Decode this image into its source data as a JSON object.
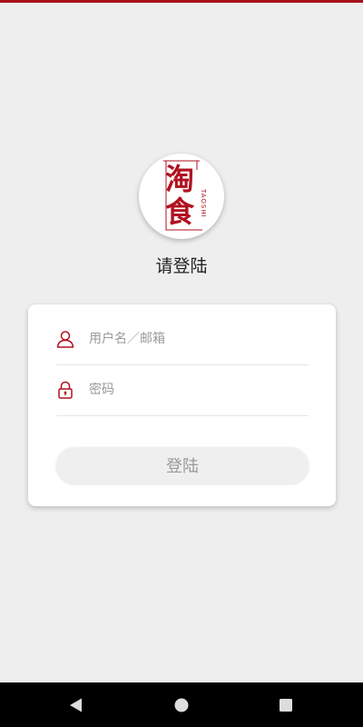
{
  "logo": {
    "chars": [
      "淘",
      "食"
    ],
    "side_text": "TAOSHI",
    "brand_color": "#b01220"
  },
  "login": {
    "title": "请登陆",
    "username_placeholder": "用户名／邮箱",
    "password_placeholder": "密码",
    "button_label": "登陆"
  },
  "icons": {
    "username": "user-icon",
    "password": "lock-icon",
    "nav_back": "back-triangle-icon",
    "nav_home": "home-circle-icon",
    "nav_recents": "recents-square-icon"
  },
  "colors": {
    "accent": "#a80f1b",
    "background": "#eeeeee",
    "card": "#ffffff",
    "button_bg": "#efefef",
    "button_text": "#9a9a9a"
  }
}
